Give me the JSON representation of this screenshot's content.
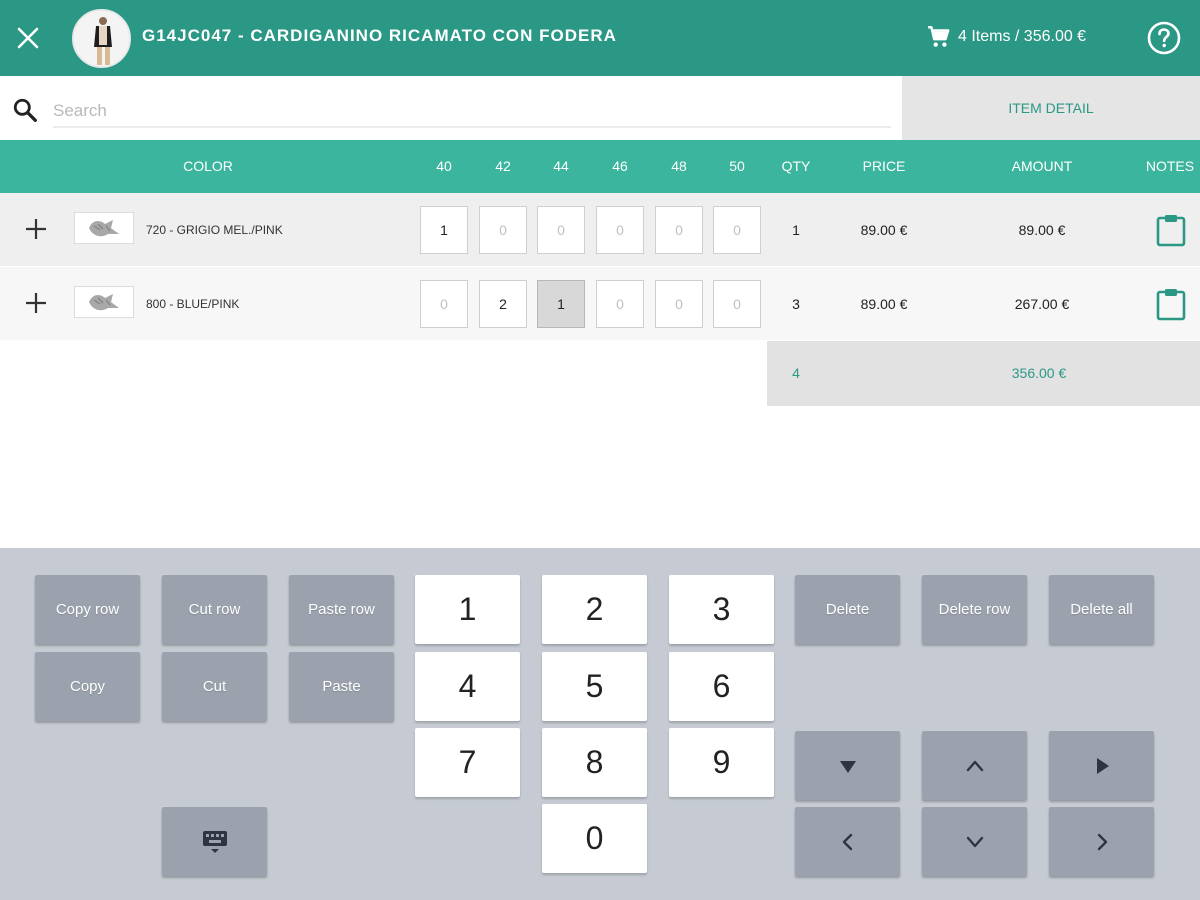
{
  "header": {
    "title": "G14JC047 - CARDIGANINO RICAMATO CON FODERA",
    "cart_summary": "4 Items / 356.00 €"
  },
  "search": {
    "placeholder": "Search"
  },
  "item_detail_label": "ITEM DETAIL",
  "table": {
    "headers": {
      "color": "COLOR",
      "qty": "QTY",
      "price": "PRICE",
      "amount": "AMOUNT",
      "notes": "NOTES"
    },
    "sizes": [
      "40",
      "42",
      "44",
      "46",
      "48",
      "50"
    ],
    "rows": [
      {
        "color": "720 - GRIGIO MEL./PINK",
        "quantities": [
          "1",
          "0",
          "0",
          "0",
          "0",
          "0"
        ],
        "qty": "1",
        "price": "89.00 €",
        "amount": "89.00 €"
      },
      {
        "color": "800 - BLUE/PINK",
        "quantities": [
          "0",
          "2",
          "1",
          "0",
          "0",
          "0"
        ],
        "qty": "3",
        "price": "89.00 €",
        "amount": "267.00 €"
      }
    ],
    "totals": {
      "qty": "4",
      "amount": "356.00 €"
    }
  },
  "keypad": {
    "copy_row": "Copy row",
    "cut_row": "Cut row",
    "paste_row": "Paste row",
    "copy": "Copy",
    "cut": "Cut",
    "paste": "Paste",
    "delete": "Delete",
    "delete_row": "Delete row",
    "delete_all": "Delete all",
    "digits": [
      "1",
      "2",
      "3",
      "4",
      "5",
      "6",
      "7",
      "8",
      "9",
      "0"
    ]
  },
  "colors": {
    "header": "#2b9885",
    "table_header": "#3bb59d",
    "keypad_bg": "#c6cbd3",
    "action_button": "#9ba2ad"
  }
}
